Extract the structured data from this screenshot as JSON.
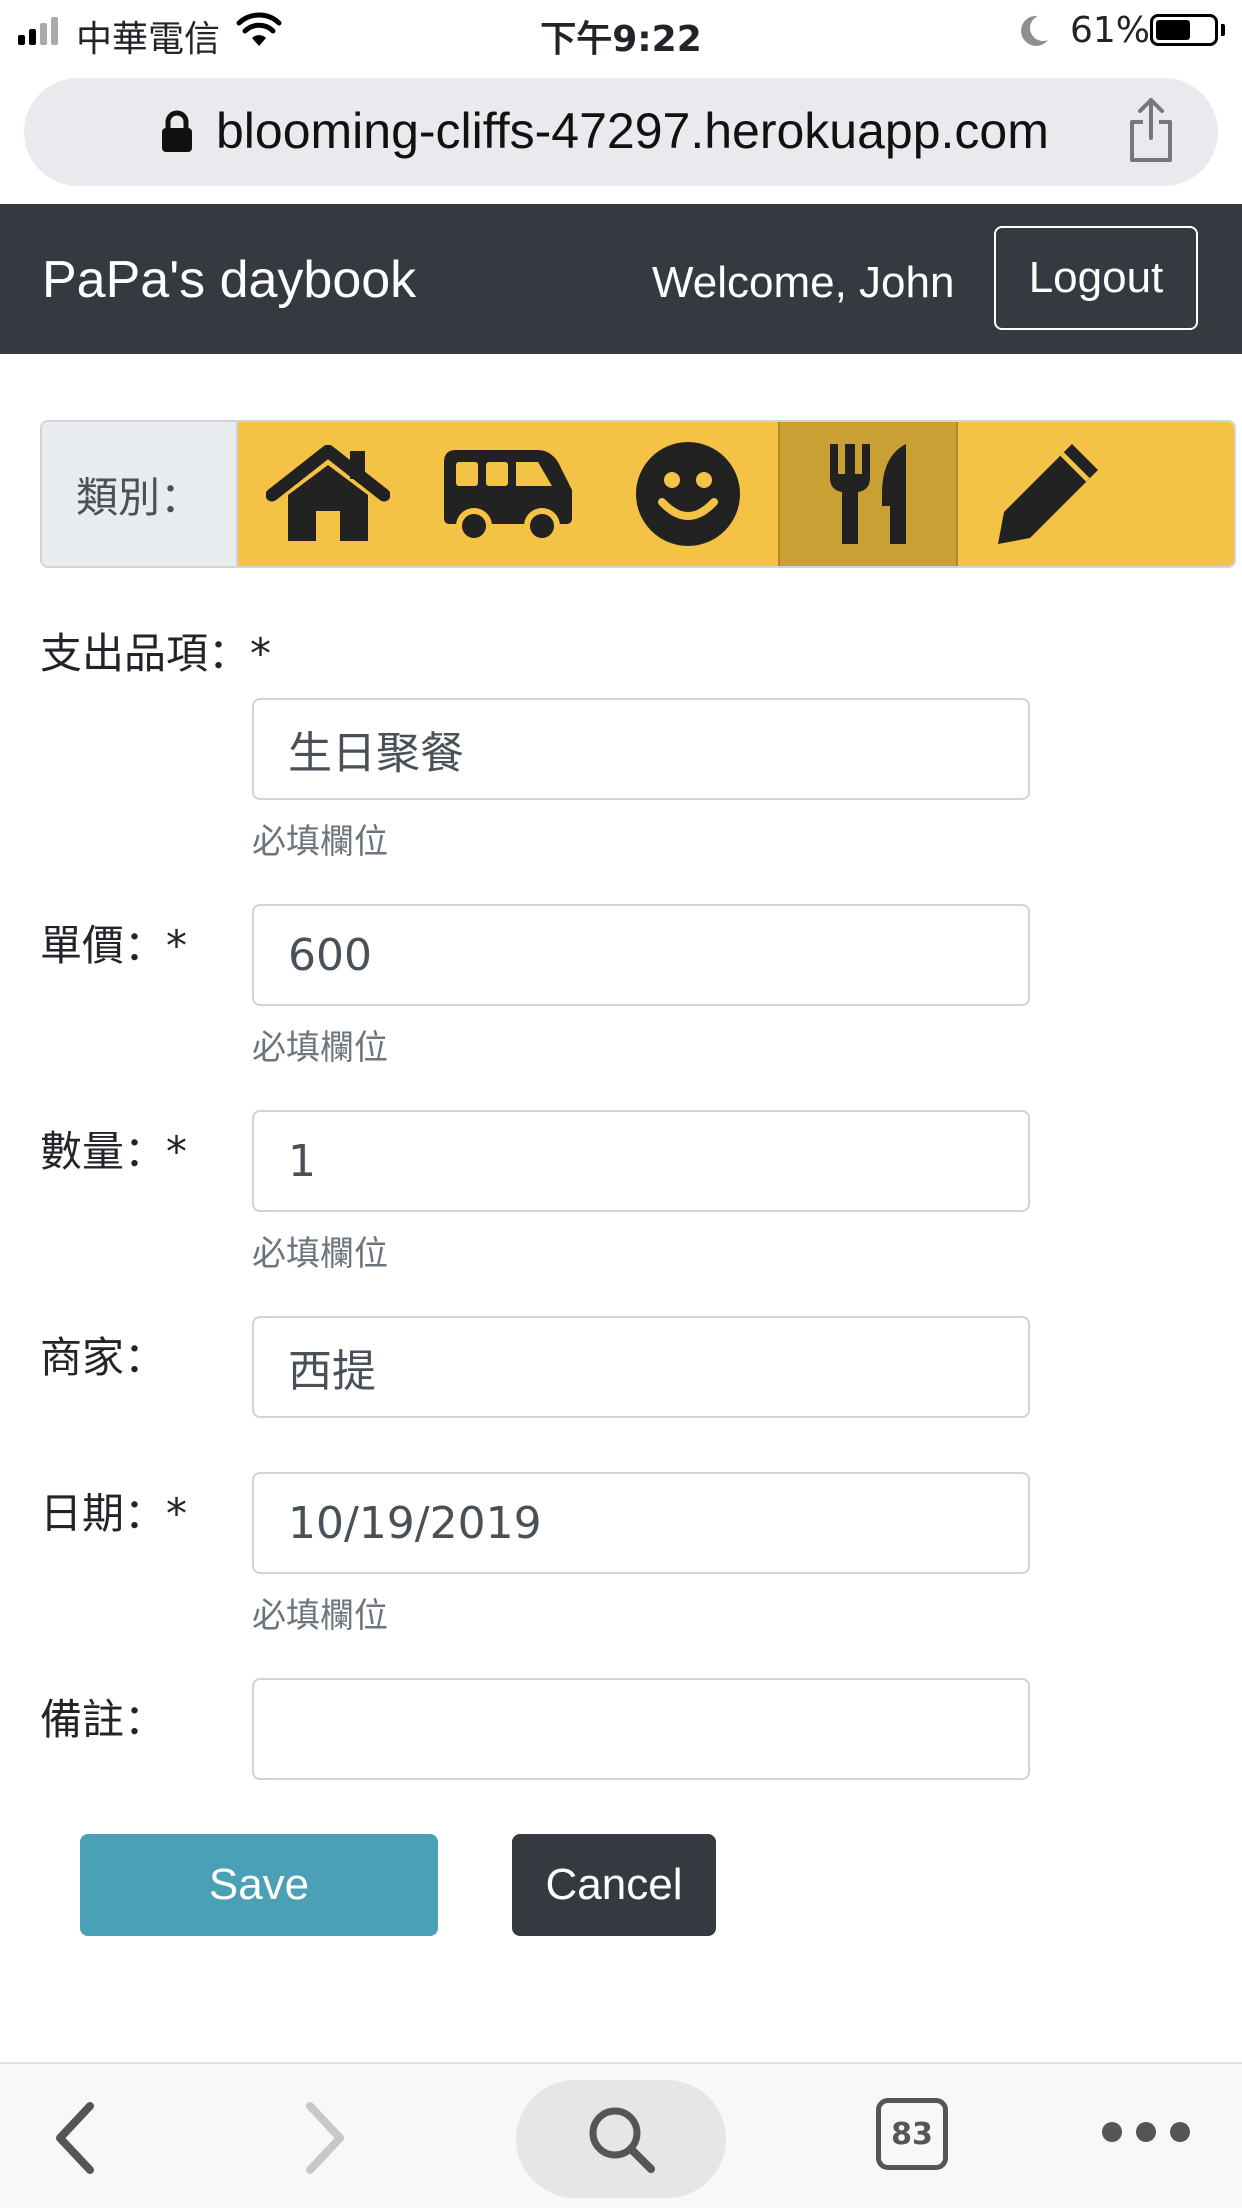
{
  "status_bar": {
    "carrier": "中華電信",
    "time": "下午9:22",
    "battery": "61%",
    "battery_level": 0.61,
    "icons": [
      "signal-icon",
      "wifi-icon",
      "moon-icon",
      "battery-icon"
    ]
  },
  "browser": {
    "url": "blooming-cliffs-47297.herokuapp.com",
    "tab_count": "83",
    "icons": [
      "lock-icon",
      "share-icon",
      "back-icon",
      "forward-icon",
      "search-icon",
      "tabs-icon",
      "more-icon"
    ]
  },
  "navbar": {
    "brand": "PaPa's daybook",
    "welcome": "Welcome, John",
    "logout": "Logout"
  },
  "category": {
    "label": "類別：",
    "options": [
      {
        "icon": "home-icon",
        "selected": false
      },
      {
        "icon": "van-icon",
        "selected": false
      },
      {
        "icon": "smile-icon",
        "selected": false
      },
      {
        "icon": "utensils-icon",
        "selected": true
      },
      {
        "icon": "pencil-icon",
        "selected": false
      }
    ],
    "colors": {
      "bar": "#f4c345",
      "selected": "#c9a033"
    }
  },
  "form": {
    "item": {
      "label": "支出品項：*",
      "value": "生日聚餐",
      "help": "必填欄位"
    },
    "price": {
      "label": "單價：*",
      "value": "600",
      "help": "必填欄位"
    },
    "quantity": {
      "label": "數量：*",
      "value": "1",
      "help": "必填欄位"
    },
    "merchant": {
      "label": "商家：",
      "value": "西提"
    },
    "date": {
      "label": "日期：*",
      "value": "10/19/2019",
      "help": "必填欄位"
    },
    "note": {
      "label": "備註：",
      "value": ""
    }
  },
  "actions": {
    "save": "Save",
    "cancel": "Cancel",
    "colors": {
      "save": "#4aa0b5",
      "cancel": "#343a40"
    }
  }
}
